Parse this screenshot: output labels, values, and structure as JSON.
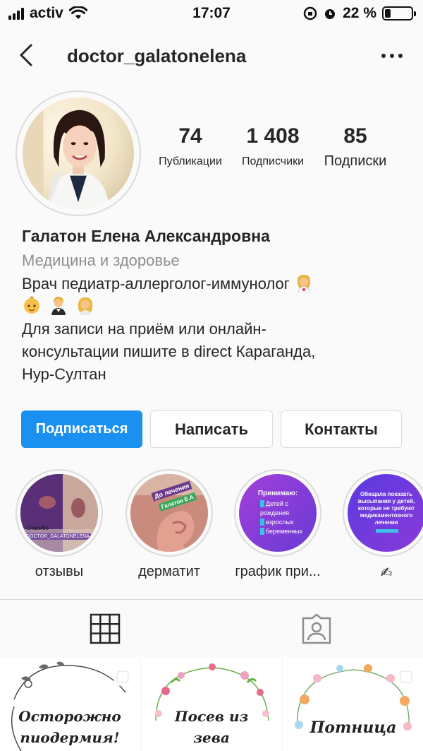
{
  "status_bar": {
    "carrier": "activ",
    "time": "17:07",
    "battery_percent": "22 %",
    "battery_level": 0.22
  },
  "nav": {
    "username": "doctor_galatonelena",
    "back_icon": "chevron-left-icon",
    "more_icon": "more-horizontal-icon"
  },
  "stats": [
    {
      "value": "74",
      "label": "Публикации"
    },
    {
      "value": "1 408",
      "label": "Подписчики"
    },
    {
      "value": "85",
      "label": "Подписки"
    }
  ],
  "bio": {
    "name": "Галатон Елена Александровна",
    "category": "Медицина и здоровье",
    "line1": "Врач педиатр-аллерголог-иммунолог",
    "line3": "Для записи на приём или онлайн-",
    "line4": "консультации пишите в direct Караганда,",
    "line5": "Нур-Султан"
  },
  "buttons": {
    "follow": "Подписаться",
    "message": "Написать",
    "contacts": "Контакты"
  },
  "highlights": [
    {
      "label": "отзывы",
      "caption": "Спасибо",
      "caption2": "DOCTOR_GALATONELENA"
    },
    {
      "label": "дерматит",
      "caption": "До лечения",
      "caption2": "Галатон Е.А"
    },
    {
      "label": "график при...",
      "caption": "Принимаю:",
      "items": [
        "Детей с",
        "рождения",
        "взрослых",
        "беременных"
      ]
    },
    {
      "label": "✍",
      "caption": "Обещала показать высыпания у детей, которые не требуют медикаментозного лечения"
    }
  ],
  "tabs": {
    "grid_icon": "grid-icon",
    "tagged_icon": "tagged-person-icon"
  },
  "posts": [
    {
      "title_line1": "Осторожно",
      "title_line2": "пиодермия!"
    },
    {
      "title_line1": "Посев из",
      "title_line2": "зева"
    },
    {
      "title_line1": "Потница",
      "title_line2": ""
    }
  ],
  "colors": {
    "accent": "#1a90f0",
    "text": "#262626",
    "muted": "#8e8e8e",
    "border": "#dbdbdb"
  }
}
